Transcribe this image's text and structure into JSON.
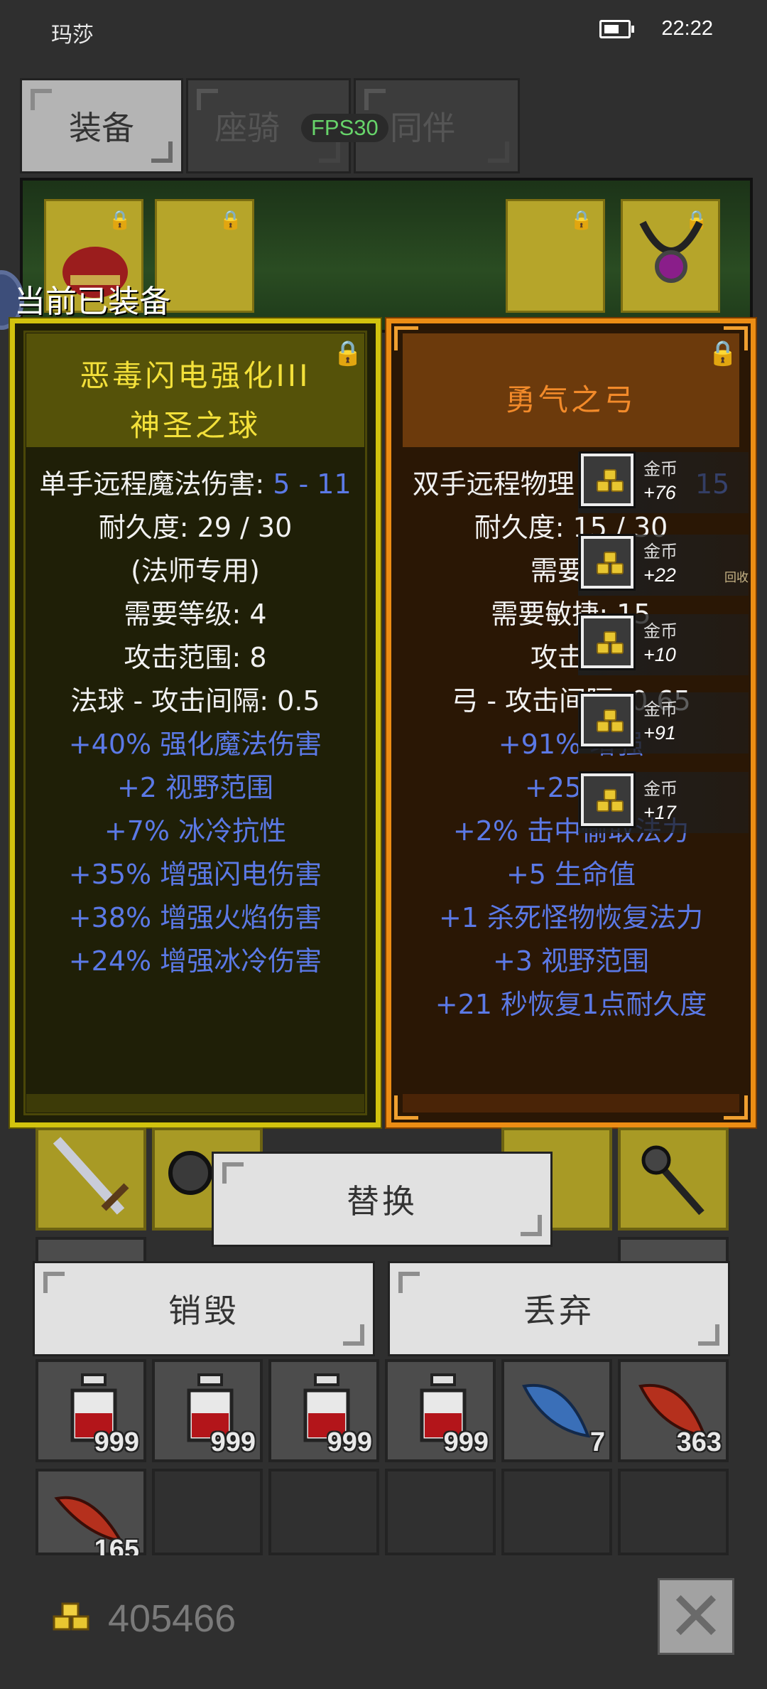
{
  "status_bar": {
    "carrier": "玛莎",
    "time": "22:22"
  },
  "tabs": [
    {
      "label": "装备",
      "active": true
    },
    {
      "label": "座骑",
      "active": false
    },
    {
      "label": "同伴",
      "active": false
    }
  ],
  "fps_label": "FPS30",
  "equipped_label": "当前已装备",
  "left_item": {
    "title_line1": "恶毒闪电强化III",
    "title_line2": "神圣之球",
    "stats": [
      {
        "label": "单手远程魔法伤害: ",
        "value": "5 - 11",
        "style": "w"
      },
      {
        "label": "耐久度: 29 / 30",
        "style": "w"
      },
      {
        "label": "(法师专用)",
        "style": "w"
      },
      {
        "label": "需要等级: 4",
        "style": "w"
      },
      {
        "label": "攻击范围: 8",
        "style": "w"
      },
      {
        "label": "法球 - 攻击间隔: 0.5",
        "style": "w"
      },
      {
        "label": "+40% 强化魔法伤害",
        "style": "b"
      },
      {
        "label": "+2 视野范围",
        "style": "b"
      },
      {
        "label": "+7% 冰冷抗性",
        "style": "b"
      },
      {
        "label": "+35% 增强闪电伤害",
        "style": "b"
      },
      {
        "label": "+38% 增强火焰伤害",
        "style": "b"
      },
      {
        "label": "+24% 增强冰冷伤害",
        "style": "b"
      }
    ]
  },
  "right_item": {
    "title": "勇气之弓",
    "stats": [
      {
        "label": "双手远程物理",
        "value": "15",
        "style": "w"
      },
      {
        "label": "耐久度: 15 / 30",
        "style": "w"
      },
      {
        "label": "需要等",
        "style": "w"
      },
      {
        "label": "需要敏捷: 15",
        "style": "w"
      },
      {
        "label": "攻击范",
        "style": "w"
      },
      {
        "label": "弓 - 攻击间隔: 0.65",
        "style": "w"
      },
      {
        "label": "+91% 增强",
        "style": "b"
      },
      {
        "label": "+25 准",
        "style": "b"
      },
      {
        "label": "+2% 击中偷取法力",
        "style": "b"
      },
      {
        "label": "+5 生命值",
        "style": "b"
      },
      {
        "label": "+1 杀死怪物恢复法力",
        "style": "b"
      },
      {
        "label": "+3 视野范围",
        "style": "b"
      },
      {
        "label": "+21 秒恢复1点耐久度",
        "style": "b"
      }
    ]
  },
  "gold_toasts": [
    {
      "label": "金币",
      "amount": "+76"
    },
    {
      "label": "金币",
      "amount": "+22",
      "extra": "回收"
    },
    {
      "label": "金币",
      "amount": "+10"
    },
    {
      "label": "金币",
      "amount": "+91"
    },
    {
      "label": "金币",
      "amount": "+17"
    }
  ],
  "buttons": {
    "replace": "替换",
    "destroy": "销毁",
    "discard": "丢弃"
  },
  "inventory": {
    "row3": [
      "999",
      "999",
      "999",
      "999",
      "7",
      "363"
    ],
    "row4": [
      "165"
    ]
  },
  "gold_total": "405466",
  "colors": {
    "left_border": "#d2c30e",
    "right_border": "#ec8d14",
    "stat_blue": "#5b79e6",
    "left_title": "#f3e03a",
    "right_title": "#f28a2a"
  },
  "icons": [
    "battery-icon",
    "lock-icon",
    "gold-coin-icon",
    "close-icon",
    "potion-icon",
    "feather-icon",
    "sword-icon",
    "mace-icon",
    "helmet-icon",
    "amulet-icon"
  ]
}
